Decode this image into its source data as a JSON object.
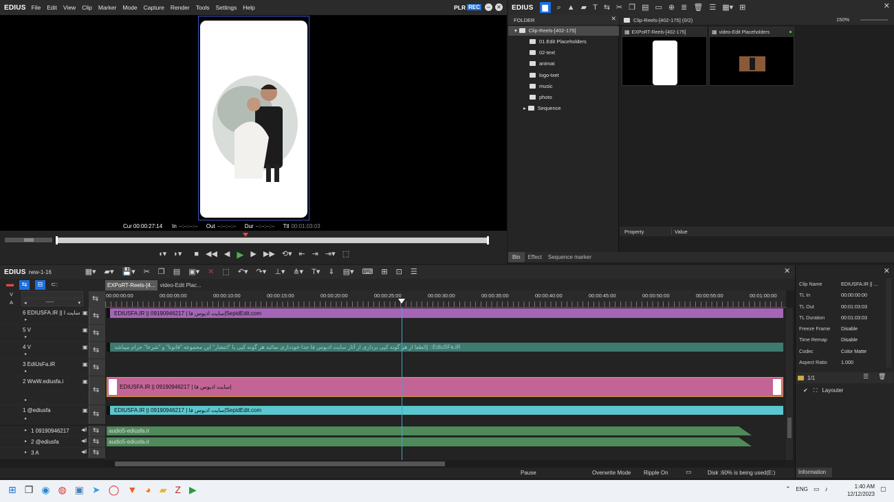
{
  "menu": {
    "logo": "EDIUS",
    "items": [
      "File",
      "Edit",
      "View",
      "Clip",
      "Marker",
      "Mode",
      "Capture",
      "Render",
      "Tools",
      "Settings",
      "Help"
    ]
  },
  "player": {
    "plr": "PLR",
    "rec": "REC",
    "cur_label": "Cur",
    "cur": "00:00:27:14",
    "in_label": "In",
    "in": "--:--:--:--",
    "out_label": "Out",
    "out": "--:--:--:--",
    "dur_label": "Dur",
    "dur": "--:--:--:--",
    "ttl_label": "Ttl",
    "ttl": "00:01:03:03"
  },
  "bin": {
    "logo": "EDIUS",
    "folder_header": "FOLDER",
    "path": "Clip-Reels-[402-175] (0/2)",
    "zoom": "150%",
    "tree": [
      "Clip-Reels-[402-175]",
      "01.Edit Placeholders",
      "02-text",
      "animat",
      "logo-txet",
      "music",
      "photo",
      "Sequence"
    ],
    "clips": [
      "EXPoRT-Reels-[402-175]",
      "video-Edit Placeholders"
    ],
    "property_col": "Property",
    "value_col": "Value",
    "tabs": [
      "Bin",
      "Effect",
      "Sequence marker"
    ]
  },
  "timeline": {
    "logo": "EDIUS",
    "project": "new-1-16",
    "seq_tabs": [
      "EXPoRT-Reels-[4...",
      "video-Edit Plac..."
    ],
    "ruler": [
      "00:00:00:00",
      "00:00:05:00",
      "00:00:10:00",
      "00:00:15:00",
      "00:00:20:00",
      "00:00:25:00",
      "00:00:30:00",
      "00:00:35:00",
      "00:00:40:00",
      "00:00:45:00",
      "00:00:50:00",
      "00:00:55:00",
      "00:01:00:00"
    ],
    "v_label": "V",
    "a_label": "A",
    "dash": "-----",
    "tracks": [
      "6 EDIUSFA.IR || سایت ا",
      "5 V",
      "4 V",
      "3 EdiUsFa.iR",
      "2 WwW.ediusfa.i",
      "1 @ediusfa"
    ],
    "audio_tracks": [
      "1 09190946217",
      "2 @ediusfa",
      "3 A"
    ],
    "clips": {
      "t6": "EDIUSFA.IR || 09190946217  |  سایت ادیوس فا|SepidEdit.com",
      "t4": "لطفا از هر گونه کپی برداری از آثار سایت ادیوس فا  جدا خودداری نمائید هر گونه کپی یا \"انتشار\" این مجموعه \"قانونا\" و \"شرعا\" حرام میباشد|| ::EdiuSFa.iR",
      "t2": "EDIUSFA.IR || 09190946217  |  سایت ادیوس فا|",
      "t1": "EDIUSFA.IR || 09190946217  |  سایت ادیوس فا|SepidEdit.com",
      "a1": "audio5-ediusfa.ir",
      "a2": "audio5-ediusfa.ir"
    }
  },
  "info": {
    "rows": [
      [
        "Clip Name",
        "EDIUSFA.IR || ..."
      ],
      [
        "TL In",
        "00:00:00:00"
      ],
      [
        "TL Out",
        "00:01:03:03"
      ],
      [
        "TL Duration",
        "00:01:03:03"
      ],
      [
        "Freeze Frame",
        "Disable"
      ],
      [
        "Time Remap",
        "Disable"
      ],
      [
        "Codec",
        "Color Matte"
      ],
      [
        "Aspect Ratio",
        "1.000"
      ]
    ],
    "page": "1/1",
    "layer": "Layouter",
    "tab": "Information"
  },
  "status": {
    "pause": "Pause",
    "mode": "Overwrite Mode",
    "ripple": "Ripple On",
    "disk": "Disk :60% is being used(E:)"
  },
  "taskbar": {
    "lang": "ENG",
    "time": "1:40 AM",
    "date": "12/12/2023"
  },
  "colors": {
    "purple": "#a465b6",
    "teal": "#3f7a70",
    "pink": "#c46496",
    "cyan": "#5bc6cd",
    "green": "#4f8a5b",
    "accent": "#1e6fd9"
  }
}
